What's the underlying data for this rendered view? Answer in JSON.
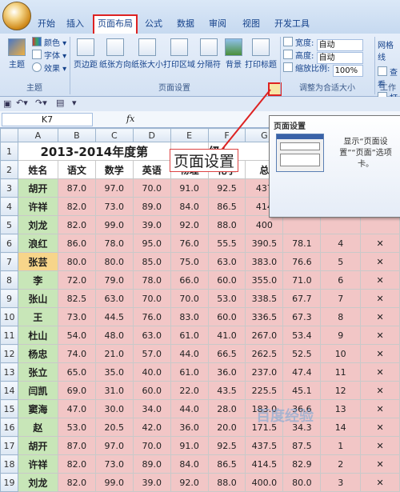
{
  "ribbon_tabs": [
    "开始",
    "插入",
    "页面布局",
    "公式",
    "数据",
    "审阅",
    "视图",
    "开发工具"
  ],
  "theme_group": {
    "label": "主题",
    "theme_btn": "主题",
    "colors": "颜色",
    "fonts": "字体",
    "effects": "效果"
  },
  "page_setup_group": {
    "label": "页面设置",
    "buttons": [
      "页边距",
      "纸张方向",
      "纸张大小",
      "打印区域",
      "分隔符",
      "背景",
      "打印标题"
    ]
  },
  "scale_group": {
    "label": "调整为合适大小",
    "width_label": "宽度:",
    "width_value": "自动",
    "height_label": "高度:",
    "height_value": "自动",
    "scale_label": "缩放比例:",
    "scale_value": "100%"
  },
  "sheet_options": {
    "gridlines": "网格线",
    "view": "查看",
    "print": "打印",
    "arrange": "工作"
  },
  "name_box": "K7",
  "fx": "fx",
  "columns": [
    "A",
    "B",
    "C",
    "D",
    "E",
    "F",
    "G",
    "H",
    "I",
    "J"
  ],
  "title_row": "2013-2014年度第",
  "title_tail": "级(",
  "headers": [
    "姓名",
    "语文",
    "数学",
    "英语",
    "物理",
    "化学",
    "总"
  ],
  "rows": [
    {
      "n": "3",
      "name": "胡开",
      "v": [
        "87.0",
        "97.0",
        "70.0",
        "91.0",
        "92.5",
        "437"
      ],
      "i": "",
      "j": ""
    },
    {
      "n": "4",
      "name": "许祥",
      "v": [
        "82.0",
        "73.0",
        "89.0",
        "84.0",
        "86.5",
        "414"
      ],
      "i": "",
      "j": ""
    },
    {
      "n": "5",
      "name": "刘龙",
      "v": [
        "82.0",
        "99.0",
        "39.0",
        "92.0",
        "88.0",
        "400"
      ],
      "i": "",
      "j": ""
    },
    {
      "n": "6",
      "name": "浪红",
      "v": [
        "86.0",
        "78.0",
        "95.0",
        "76.0",
        "55.5",
        "390.5",
        "78.1"
      ],
      "i": "4",
      "j": "✕"
    },
    {
      "n": "7",
      "name": "张芸",
      "v": [
        "80.0",
        "80.0",
        "85.0",
        "75.0",
        "63.0",
        "383.0",
        "76.6"
      ],
      "i": "5",
      "j": "✕"
    },
    {
      "n": "8",
      "name": "李",
      "v": [
        "72.0",
        "79.0",
        "78.0",
        "66.0",
        "60.0",
        "355.0",
        "71.0"
      ],
      "i": "6",
      "j": "✕"
    },
    {
      "n": "9",
      "name": "张山",
      "v": [
        "82.5",
        "63.0",
        "70.0",
        "70.0",
        "53.0",
        "338.5",
        "67.7"
      ],
      "i": "7",
      "j": "✕"
    },
    {
      "n": "10",
      "name": "王",
      "v": [
        "73.0",
        "44.5",
        "76.0",
        "83.0",
        "60.0",
        "336.5",
        "67.3"
      ],
      "i": "8",
      "j": "✕"
    },
    {
      "n": "11",
      "name": "杜山",
      "v": [
        "54.0",
        "48.0",
        "63.0",
        "61.0",
        "41.0",
        "267.0",
        "53.4"
      ],
      "i": "9",
      "j": "✕"
    },
    {
      "n": "12",
      "name": "杨忠",
      "v": [
        "74.0",
        "21.0",
        "57.0",
        "44.0",
        "66.5",
        "262.5",
        "52.5"
      ],
      "i": "10",
      "j": "✕"
    },
    {
      "n": "13",
      "name": "张立",
      "v": [
        "65.0",
        "35.0",
        "40.0",
        "61.0",
        "36.0",
        "237.0",
        "47.4"
      ],
      "i": "11",
      "j": "✕"
    },
    {
      "n": "14",
      "name": "闫凯",
      "v": [
        "69.0",
        "31.0",
        "60.0",
        "22.0",
        "43.5",
        "225.5",
        "45.1"
      ],
      "i": "12",
      "j": "✕"
    },
    {
      "n": "15",
      "name": "窦海",
      "v": [
        "47.0",
        "30.0",
        "34.0",
        "44.0",
        "28.0",
        "183.0",
        "36.6"
      ],
      "i": "13",
      "j": "✕"
    },
    {
      "n": "16",
      "name": "赵",
      "v": [
        "53.0",
        "20.5",
        "42.0",
        "36.0",
        "20.0",
        "171.5",
        "34.3"
      ],
      "i": "14",
      "j": "✕"
    },
    {
      "n": "17",
      "name": "胡开",
      "v": [
        "87.0",
        "97.0",
        "70.0",
        "91.0",
        "92.5",
        "437.5",
        "87.5"
      ],
      "i": "1",
      "j": "✕"
    },
    {
      "n": "18",
      "name": "许祥",
      "v": [
        "82.0",
        "73.0",
        "89.0",
        "84.0",
        "86.5",
        "414.5",
        "82.9"
      ],
      "i": "2",
      "j": "✕"
    },
    {
      "n": "19",
      "name": "刘龙",
      "v": [
        "82.0",
        "99.0",
        "39.0",
        "92.0",
        "88.0",
        "400.0",
        "80.0"
      ],
      "i": "3",
      "j": "✕"
    }
  ],
  "tooltip": {
    "title": "页面设置",
    "desc": "显示“页面设置”“页面”选项卡。"
  },
  "callout": "页面设置",
  "watermark": "百度经验",
  "colors": {
    "name_bg": "#c8e6b8",
    "num_bg": "#f2c6c6",
    "selected": "#f7d58a",
    "highlight": "#dd2222"
  }
}
